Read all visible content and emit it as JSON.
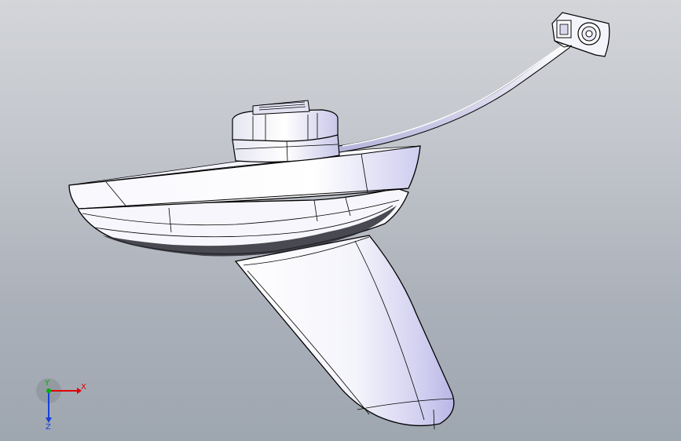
{
  "viewport": {
    "background_top": "#d3d5d9",
    "background_bottom": "#9ea6b0"
  },
  "model": {
    "part_color": "#ffffff",
    "shade_color": "#c9c8ee",
    "edge_color": "#000000"
  },
  "triad": {
    "x_label": "X",
    "y_label": "Y",
    "z_label": "Z",
    "x_color": "#e00000",
    "y_color": "#00b000",
    "z_color": "#1a3fd8"
  }
}
